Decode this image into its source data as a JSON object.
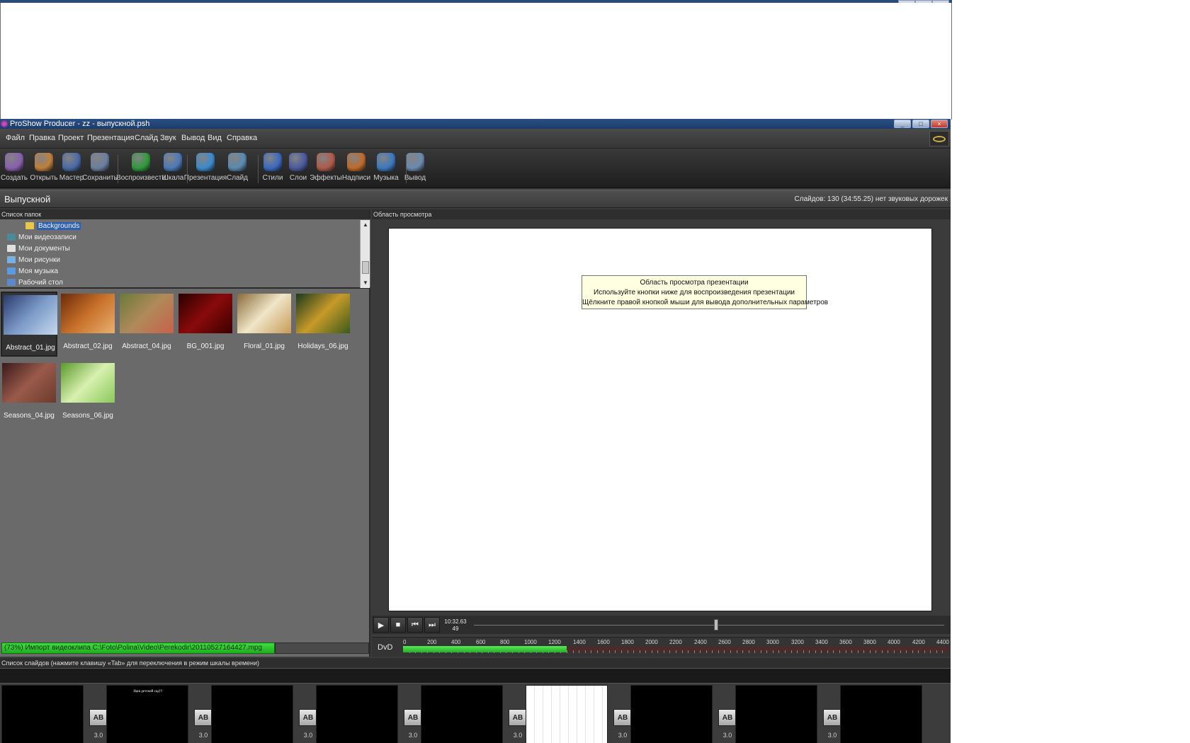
{
  "window": {
    "title": "ProShow Producer - zz - выпускной.psh",
    "controls": [
      "_",
      "□",
      "×"
    ]
  },
  "menu": [
    "Файл",
    "Правка",
    "Проект",
    "Презентация",
    "Слайд",
    "Звук",
    "Вывод",
    "Вид",
    "Справка"
  ],
  "toolbar": [
    {
      "label": "Создать",
      "icon": "create-icon",
      "color": "#8a5fb0"
    },
    {
      "label": "Открыть",
      "icon": "open-icon",
      "color": "#c07f3a"
    },
    {
      "label": "Мастер",
      "icon": "wizard-icon",
      "color": "#4a6aa8"
    },
    {
      "label": "Сохранить",
      "icon": "save-icon",
      "color": "#6a7fa0"
    },
    {
      "label": "Воспроизвести",
      "icon": "play-icon",
      "color": "#2e9a3c"
    },
    {
      "label": "Шкала",
      "icon": "timeline-icon",
      "color": "#4a7ab8"
    },
    {
      "label": "Презентация",
      "icon": "show-icon",
      "color": "#3a8ad0"
    },
    {
      "label": "Слайд",
      "icon": "slide-icon",
      "color": "#5a8ab0"
    },
    {
      "label": "Стили",
      "icon": "styles-icon",
      "color": "#3a6ac0"
    },
    {
      "label": "Слои",
      "icon": "layers-icon",
      "color": "#4a5aa0"
    },
    {
      "label": "Эффекты",
      "icon": "effects-icon",
      "color": "#b05a4a"
    },
    {
      "label": "Надписи",
      "icon": "captions-icon",
      "color": "#c06a2a"
    },
    {
      "label": "Музыка",
      "icon": "music-icon",
      "color": "#3a7ac0"
    },
    {
      "label": "Вывод",
      "icon": "output-icon",
      "color": "#6a8ab0"
    }
  ],
  "show": {
    "title": "Выпускной",
    "stats": "Слайдов: 130 (34:55.25)  нет звуковых дорожек"
  },
  "folders": {
    "header": "Список папок",
    "items": [
      {
        "label": "Backgrounds",
        "icon": "folder-icon",
        "color": "#e8c84a",
        "selected": true
      },
      {
        "label": "Мои видеозаписи",
        "icon": "video-folder-icon",
        "color": "#4a8a9a",
        "selected": false
      },
      {
        "label": "Мои документы",
        "icon": "documents-folder-icon",
        "color": "#e0e0e0",
        "selected": false
      },
      {
        "label": "Мои рисунки",
        "icon": "pictures-folder-icon",
        "color": "#7ab0e0",
        "selected": false
      },
      {
        "label": "Моя музыка",
        "icon": "music-folder-icon",
        "color": "#5a9ae0",
        "selected": false
      },
      {
        "label": "Рабочий стол",
        "icon": "desktop-icon",
        "color": "#5a8ac8",
        "selected": false
      }
    ]
  },
  "files": [
    {
      "name": "Abstract_01.jpg",
      "selected": true,
      "colors": [
        "#2a3a6a",
        "#7a9ac8",
        "#c8d8ee"
      ]
    },
    {
      "name": "Abstract_02.jpg",
      "selected": false,
      "colors": [
        "#6a2a0a",
        "#c8702a",
        "#e8b070"
      ]
    },
    {
      "name": "Abstract_04.jpg",
      "selected": false,
      "colors": [
        "#6a7a3a",
        "#b08a5a",
        "#c8604a"
      ]
    },
    {
      "name": "BG_001.jpg",
      "selected": false,
      "colors": [
        "#2a0000",
        "#8a0a0a",
        "#3a0000"
      ]
    },
    {
      "name": "Floral_01.jpg",
      "selected": false,
      "colors": [
        "#8a6a3a",
        "#f0e6c8",
        "#c89a5a"
      ]
    },
    {
      "name": "Holidays_06.jpg",
      "selected": false,
      "colors": [
        "#1a3a1a",
        "#c89a2a",
        "#3a5a1a"
      ]
    },
    {
      "name": "Seasons_04.jpg",
      "selected": false,
      "colors": [
        "#3a1a1a",
        "#9a5a4a",
        "#6a3a2a"
      ]
    },
    {
      "name": "Seasons_06.jpg",
      "selected": false,
      "colors": [
        "#5a9a2a",
        "#d8f0b0",
        "#8ac85a"
      ]
    }
  ],
  "status": {
    "text": "(73%) Импорт видеоклипа C:\\Foto\\Polina\\Video\\Perekodir\\20110527164427.mpg",
    "progress": 0.73
  },
  "preview": {
    "header": "Область просмотра",
    "tooltip": [
      "Область просмотра презентации",
      "Используйте кнопки ниже для воспроизведения презентации",
      "Щёлкните правой кнопкой мыши для вывода дополнительных параметров"
    ],
    "timecode": "10:32.63",
    "frame": "49",
    "seek_fraction": 0.54
  },
  "dvd": {
    "label": "DvD",
    "ticks": [
      "0",
      "200",
      "400",
      "600",
      "800",
      "1000",
      "1200",
      "1400",
      "1600",
      "1800",
      "2000",
      "2200",
      "2400",
      "2600",
      "2800",
      "3000",
      "3200",
      "3400",
      "3600",
      "3800",
      "4000",
      "4200",
      "4400"
    ],
    "max": 4500,
    "used": 1350
  },
  "slides": {
    "header": "Список слайдов (нажмите клавишу «Tab» для переключения в режим шкалы времени)",
    "items": [
      {
        "caption": "",
        "white": false,
        "time": "3.0"
      },
      {
        "caption": "Наш детский сад!!!",
        "white": false,
        "time": "3.0"
      },
      {
        "caption": "",
        "white": false,
        "time": "3.0"
      },
      {
        "caption": "",
        "white": false,
        "time": "3.0"
      },
      {
        "caption": "",
        "white": false,
        "time": "3.0"
      },
      {
        "caption": "",
        "white": true,
        "time": "3.0"
      },
      {
        "caption": "",
        "white": false,
        "time": "3.0"
      },
      {
        "caption": "",
        "white": false,
        "time": "3.0"
      },
      {
        "caption": "",
        "white": false,
        "time": ""
      }
    ]
  }
}
